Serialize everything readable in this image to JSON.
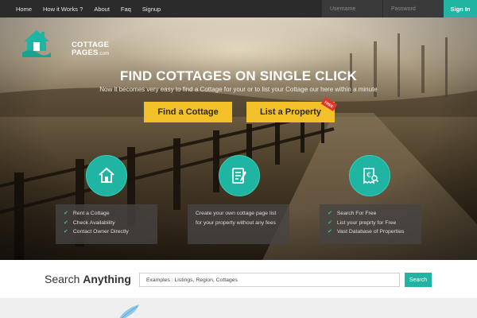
{
  "nav": {
    "links": [
      "Home",
      "How it Works ?",
      "About",
      "Faq",
      "Signup"
    ],
    "username_placeholder": "Username",
    "password_placeholder": "Password",
    "signin_label": "Sign In"
  },
  "logo": {
    "line1": "COTTAGE",
    "line2": "PAGES",
    "suffix": ".com",
    "icon": "house-hand-logo-icon"
  },
  "hero": {
    "headline": "FIND COTTAGES ON SINGLE CLICK",
    "subline": "Now it becomes very easy to find a Cottage for your or to list your Cottage our here within a minute",
    "find_button": "Find a Cottage",
    "list_button": "List a Property",
    "free_tag": "FREE"
  },
  "features": [
    {
      "icon": "home-icon",
      "items": [
        "Rent a Cottage",
        "Check Availability",
        "Contact Owner Directly"
      ]
    },
    {
      "icon": "document-edit-icon",
      "text": "Create your own cottage page list for your property without any fees"
    },
    {
      "icon": "euro-receipt-icon",
      "items": [
        "Search For Free",
        "List your preprty for Free",
        "Vast Database of Properties"
      ]
    }
  ],
  "search": {
    "title_light": "Search",
    "title_bold": "Anything",
    "placeholder": "Examples : Listings, Region, Cottages",
    "button": "Search"
  },
  "colors": {
    "accent": "#1fb5a2",
    "button_yellow": "#f2c12a",
    "nav_bg": "#2b2b2b",
    "tag_red": "#e0352b"
  }
}
